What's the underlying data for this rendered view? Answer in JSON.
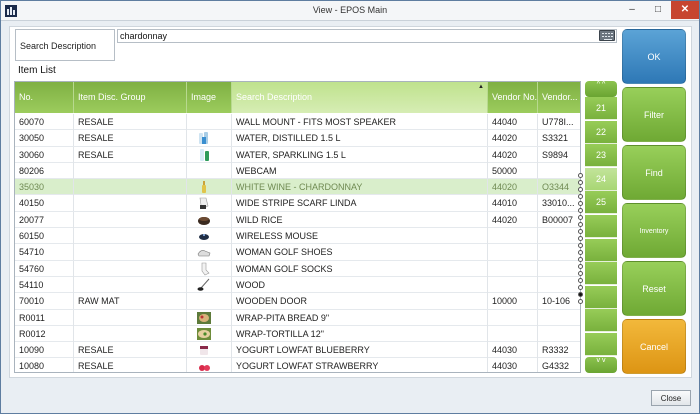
{
  "window": {
    "title": "View - EPOS Main"
  },
  "search": {
    "label": "Search Description",
    "value": "chardonnay"
  },
  "list": {
    "title": "Item List",
    "columns": [
      "No.",
      "Item Disc. Group",
      "Image",
      "Search Description",
      "Vendor No.",
      "Vendor..."
    ],
    "rows": [
      {
        "no": "60070",
        "group": "RESALE",
        "image": "",
        "desc": "WALL MOUNT - FITS MOST SPEAKER",
        "vendor": "44040",
        "vcode": "U778I..."
      },
      {
        "no": "30050",
        "group": "RESALE",
        "image": "water-bottles",
        "desc": "WATER, DISTILLED 1.5 L",
        "vendor": "44020",
        "vcode": "S3321"
      },
      {
        "no": "30060",
        "group": "RESALE",
        "image": "water-sparkling",
        "desc": "WATER, SPARKLING 1.5 L",
        "vendor": "44020",
        "vcode": "S9894"
      },
      {
        "no": "80206",
        "group": "",
        "image": "",
        "desc": "WEBCAM",
        "vendor": "50000",
        "vcode": ""
      },
      {
        "no": "35030",
        "group": "",
        "image": "wine-bottle",
        "desc": "WHITE WINE - CHARDONNAY",
        "vendor": "44020",
        "vcode": "O3344"
      },
      {
        "no": "40150",
        "group": "",
        "image": "scarf",
        "desc": "WIDE STRIPE SCARF LINDA",
        "vendor": "44010",
        "vcode": "33010..."
      },
      {
        "no": "20077",
        "group": "",
        "image": "rice-bowl",
        "desc": "WILD RICE",
        "vendor": "44020",
        "vcode": "B00007"
      },
      {
        "no": "60150",
        "group": "",
        "image": "mouse",
        "desc": "WIRELESS MOUSE",
        "vendor": "",
        "vcode": ""
      },
      {
        "no": "54710",
        "group": "",
        "image": "golf-shoes",
        "desc": "WOMAN GOLF SHOES",
        "vendor": "",
        "vcode": ""
      },
      {
        "no": "54760",
        "group": "",
        "image": "golf-socks",
        "desc": "WOMAN GOLF SOCKS",
        "vendor": "",
        "vcode": ""
      },
      {
        "no": "54110",
        "group": "",
        "image": "golf-club",
        "desc": "WOOD",
        "vendor": "",
        "vcode": ""
      },
      {
        "no": "70010",
        "group": "RAW MAT",
        "image": "",
        "desc": "WOODEN DOOR",
        "vendor": "10000",
        "vcode": "10-106"
      },
      {
        "no": "R0011",
        "group": "",
        "image": "pita",
        "desc": "WRAP-PITA BREAD 9\"",
        "vendor": "",
        "vcode": ""
      },
      {
        "no": "R0012",
        "group": "",
        "image": "tortilla",
        "desc": "WRAP-TORTILLA 12\"",
        "vendor": "",
        "vcode": ""
      },
      {
        "no": "10090",
        "group": "RESALE",
        "image": "yogurt-blueberry",
        "desc": "YOGURT LOWFAT BLUEBERRY",
        "vendor": "44030",
        "vcode": "R3332"
      },
      {
        "no": "10080",
        "group": "RESALE",
        "image": "yogurt-strawberry",
        "desc": "YOGURT LOWFAT STRAWBERRY",
        "vendor": "44030",
        "vcode": "G4332"
      }
    ],
    "selected_index": 4
  },
  "pager": {
    "up_label": "^ ^",
    "down_label": "v v",
    "pages": [
      "21",
      "22",
      "23",
      "24",
      "25",
      "",
      "",
      "",
      "",
      "",
      ""
    ],
    "current_index": 3
  },
  "side_buttons": [
    "OK",
    "Filter",
    "Find",
    "Inventory",
    "Reset",
    "Cancel"
  ],
  "footer": {
    "close_label": "Close"
  },
  "colors": {
    "accent_green": "#7fb043",
    "ok_blue": "#2e78b6",
    "cancel_orange": "#dd9514",
    "selection": "#d9eecb"
  }
}
